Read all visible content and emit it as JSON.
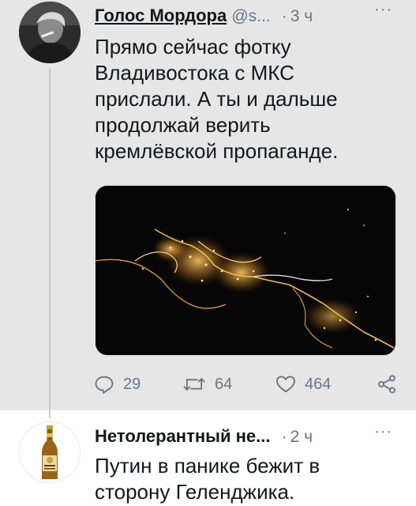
{
  "tweets": [
    {
      "author_name": "Голос Мордора",
      "handle": "@s...",
      "time": "3 ч",
      "text": "Прямо сейчас фотку Владивостока с МКС прислали. А ты и дальше продолжай верить кремлёвской пропаганде.",
      "avatar_icon": "person-photo-avatar",
      "media_icon": "city-lights-night-photo",
      "actions": {
        "reply_count": "29",
        "retweet_count": "64",
        "like_count": "464"
      }
    },
    {
      "author_name": "Нетолерантный не...",
      "time": "2 ч",
      "text": "Путин в панике бежит в сторону Геленджика.",
      "avatar_icon": "beer-bottle-avatar"
    }
  ],
  "more_glyph": "···",
  "dot_glyph": "·",
  "colors": {
    "tweet_highlight_bg": "#e6e6e6",
    "secondary_text": "#657786",
    "thread_line": "#c5ccd3"
  }
}
